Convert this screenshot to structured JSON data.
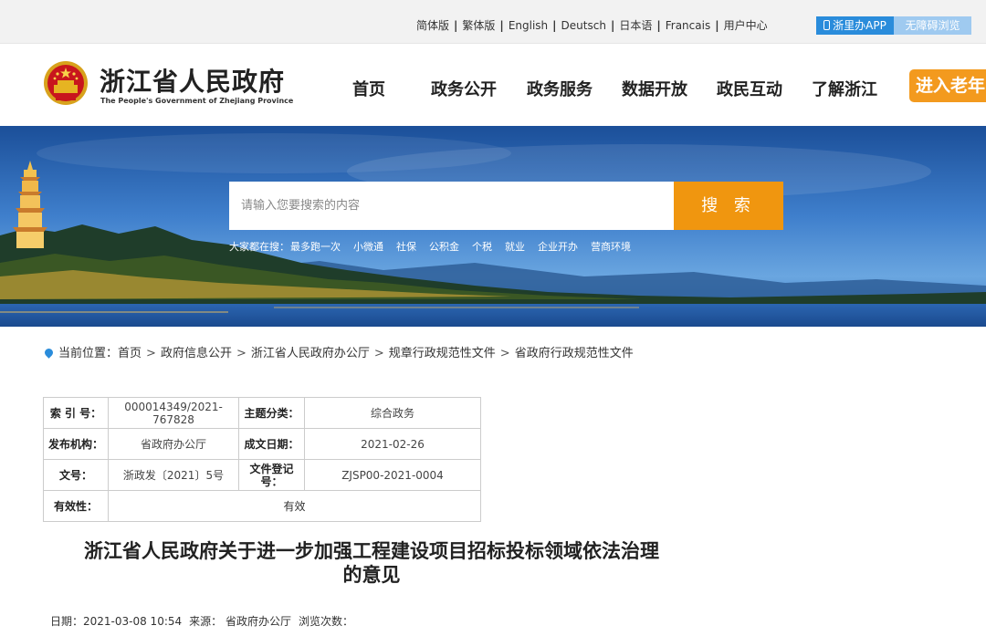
{
  "topbar": {
    "links": [
      "简体版",
      "繁体版",
      "English",
      "Deutsch",
      "日本语",
      "Francais",
      "用户中心"
    ],
    "app_label": "浙里办APP",
    "accessible_label": "无障碍浏览"
  },
  "header": {
    "title": "浙江省人民政府",
    "subtitle": "The People's Government of Zhejiang Province",
    "nav": [
      "首页",
      "政务公开",
      "政务服务",
      "数据开放",
      "政民互动",
      "了解浙江"
    ],
    "elder_label": "进入老年"
  },
  "search": {
    "placeholder": "请输入您要搜索的内容",
    "button": "搜 索",
    "hot_label": "大家都在搜：",
    "hot_items": [
      "最多跑一次",
      "小微通",
      "社保",
      "公积金",
      "个税",
      "就业",
      "企业开办",
      "营商环境"
    ]
  },
  "breadcrumb": {
    "label": "当前位置：",
    "items": [
      "首页",
      "政府信息公开",
      "浙江省人民政府办公厅",
      "规章行政规范性文件",
      "省政府行政规范性文件"
    ]
  },
  "info": {
    "index_key": "索 引 号：",
    "index_val": "000014349/2021-767828",
    "category_key": "主题分类：",
    "category_val": "综合政务",
    "publisher_key": "发布机构：",
    "publisher_val": "省政府办公厅",
    "date_key": "成文日期：",
    "date_val": "2021-02-26",
    "docno_key": "文号：",
    "docno_val": "浙政发〔2021〕5号",
    "reg_key": "文件登记号：",
    "reg_val": "ZJSP00-2021-0004",
    "validity_key": "有效性：",
    "validity_val": "有效"
  },
  "article": {
    "title_line1": "浙江省人民政府关于进一步加强工程建设项目招标投标领域依法治理",
    "title_line2": "的意见",
    "date": "日期：2021-03-08 10:54",
    "source": "来源： 省政府办公厅",
    "views": "浏览次数："
  },
  "colors": {
    "accent_orange": "#f0960f",
    "accent_blue": "#2a8cdb"
  }
}
